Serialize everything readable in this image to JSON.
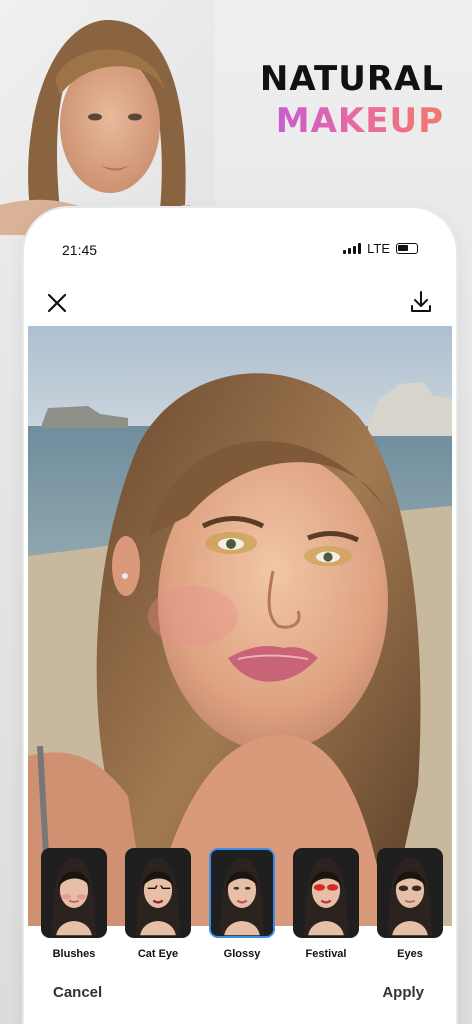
{
  "promo": {
    "headline_line1": "NATURAL",
    "headline_line2": "MAKEUP",
    "gradient_colors": [
      "#c45ad6",
      "#e96aa0",
      "#f07a6a"
    ]
  },
  "status_bar": {
    "time": "21:45",
    "network": "LTE"
  },
  "toolbar": {
    "close_icon": "close-icon",
    "download_icon": "download-icon"
  },
  "filters": [
    {
      "label": "Blushes",
      "selected": false
    },
    {
      "label": "Cat Eye",
      "selected": false
    },
    {
      "label": "Glossy",
      "selected": true
    },
    {
      "label": "Festival",
      "selected": false
    },
    {
      "label": "Eyes",
      "selected": false
    }
  ],
  "actions": {
    "cancel_label": "Cancel",
    "apply_label": "Apply"
  },
  "colors": {
    "selected_border": "#3a8ee8"
  }
}
